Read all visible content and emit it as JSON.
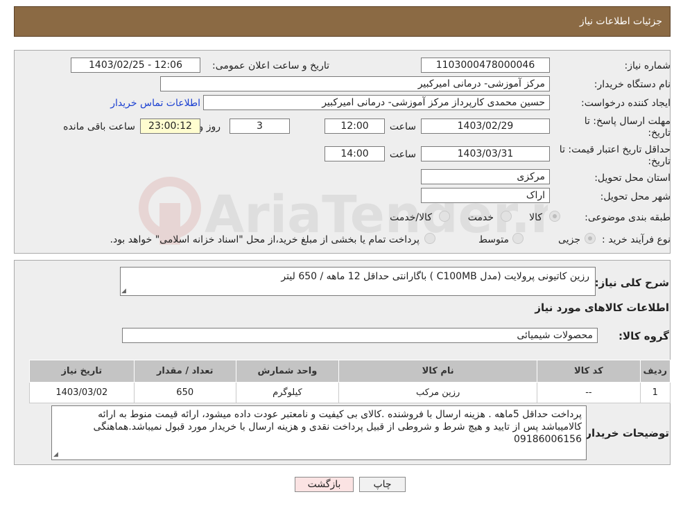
{
  "header": {
    "title": "جزئیات اطلاعات نیاز"
  },
  "watermark": {
    "text": "AriaTender.neT"
  },
  "form": {
    "need_number_label": "شماره نیاز:",
    "need_number": "1103000478000046",
    "announce_label": "تاریخ و ساعت اعلان عمومی:",
    "announce_value": "1403/02/25 - 12:06",
    "buyer_org_label": "نام دستگاه خریدار:",
    "buyer_org": "مرکز آموزشی- درمانی امیرکبیر",
    "creator_label": "ایجاد کننده درخواست:",
    "creator": "حسین  محمدی کارپرداز مرکز آموزشی- درمانی امیرکبیر",
    "contact_link": "اطلاعات تماس خریدار",
    "deadline_label": "مهلت ارسال پاسخ: تا",
    "deadline_label2": "تاریخ:",
    "deadline_date": "1403/02/29",
    "time_label": "ساعت",
    "deadline_time": "12:00",
    "days": "3",
    "day_label": "روز و",
    "remaining": "23:00:12",
    "remaining_label": "ساعت باقی مانده",
    "validity_label": "حداقل تاریخ اعتبار قیمت: تا",
    "validity_label2": "تاریخ:",
    "validity_date": "1403/03/31",
    "validity_time": "14:00",
    "province_label": "استان محل تحویل:",
    "province": "مرکزی",
    "city_label": "شهر محل تحویل:",
    "city": "اراک",
    "category_label": "طبقه بندی موضوعی:",
    "category_options": [
      "کالا",
      "خدمت",
      "کالا/خدمت"
    ],
    "process_label": "نوع فرآیند خرید :",
    "process_options": [
      "جزیی",
      "متوسط"
    ],
    "process_note": "پرداخت تمام یا بخشی از مبلغ خرید،از محل \"اسناد خزانه اسلامی\" خواهد بود."
  },
  "summary": {
    "label": "شرح کلی نیاز:",
    "text": "رزین کاتیونی پرولایت (مدل C100MB ) باگارانتی حداقل 12 ماهه /   650 لیتر",
    "items_title": "اطلاعات کالاهای مورد نیاز",
    "group_label": "گروه کالا:",
    "group_value": "محصولات شیمیائی"
  },
  "table": {
    "headers": [
      "ردیف",
      "کد کالا",
      "نام کالا",
      "واحد شمارش",
      "تعداد / مقدار",
      "تاریخ نیاز"
    ],
    "rows": [
      [
        "1",
        "--",
        "رزین مرکب",
        "کیلوگرم",
        "650",
        "1403/03/02"
      ]
    ]
  },
  "buyer_notes": {
    "label": "توضیحات خریدار:",
    "line1": "پرداخت حداقل 5ماهه . هزینه ارسال با فروشنده .کالای بی کیفیت و نامعتبر عودت داده میشود، ارائه قیمت منوط به ارائه",
    "line2": "کالامیباشد پس از تایید و هیچ شرط و شروطی از قبیل پرداخت نقدی و هزینه ارسال با خریدار مورد قبول نمیباشد.هماهنگی",
    "line3": "09186006156"
  },
  "buttons": {
    "print": "چاپ",
    "back": "بازگشت"
  }
}
